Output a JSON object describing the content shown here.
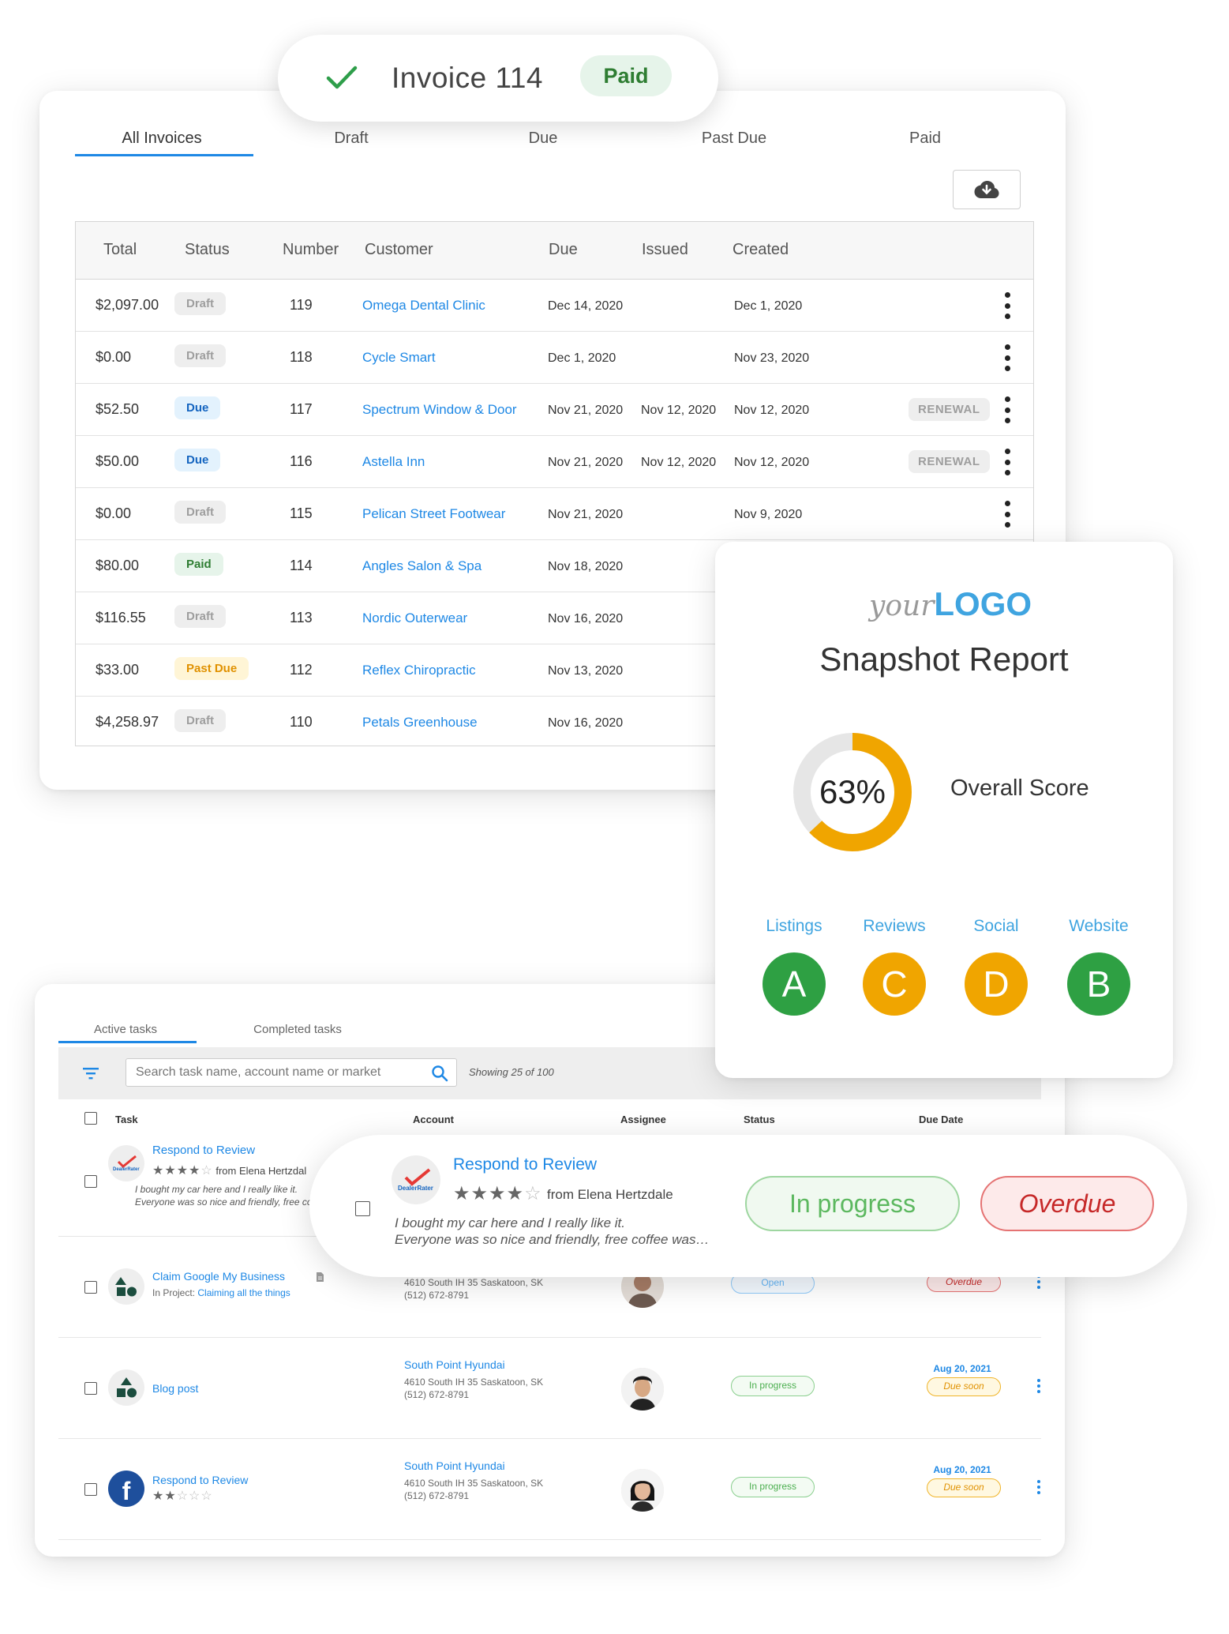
{
  "invoice_toast": {
    "title": "Invoice 114",
    "badge": "Paid"
  },
  "invoice_tabs": [
    "All Invoices",
    "Draft",
    "Due",
    "Past Due",
    "Paid"
  ],
  "invoice_table": {
    "headers": [
      "Total",
      "Status",
      "Number",
      "Customer",
      "Due",
      "Issued",
      "Created"
    ],
    "rows": [
      {
        "total": "$2,097.00",
        "status": "Draft",
        "number": "119",
        "customer": "Omega Dental Clinic",
        "due": "Dec 14, 2020",
        "issued": "",
        "created": "Dec 1, 2020",
        "tag": ""
      },
      {
        "total": "$0.00",
        "status": "Draft",
        "number": "118",
        "customer": "Cycle Smart",
        "due": "Dec 1, 2020",
        "issued": "",
        "created": "Nov 23, 2020",
        "tag": ""
      },
      {
        "total": "$52.50",
        "status": "Due",
        "number": "117",
        "customer": "Spectrum Window & Door",
        "due": "Nov 21, 2020",
        "issued": "Nov 12, 2020",
        "created": "Nov 12, 2020",
        "tag": "RENEWAL"
      },
      {
        "total": "$50.00",
        "status": "Due",
        "number": "116",
        "customer": "Astella Inn",
        "due": "Nov 21, 2020",
        "issued": "Nov 12, 2020",
        "created": "Nov 12, 2020",
        "tag": "RENEWAL"
      },
      {
        "total": "$0.00",
        "status": "Draft",
        "number": "115",
        "customer": "Pelican Street Footwear",
        "due": "Nov 21, 2020",
        "issued": "",
        "created": "Nov 9, 2020",
        "tag": ""
      },
      {
        "total": "$80.00",
        "status": "Paid",
        "number": "114",
        "customer": "Angles Salon & Spa",
        "due": "Nov 18, 2020",
        "issued": "",
        "created": "",
        "tag": ""
      },
      {
        "total": "$116.55",
        "status": "Draft",
        "number": "113",
        "customer": "Nordic Outerwear",
        "due": "Nov 16, 2020",
        "issued": "",
        "created": "",
        "tag": ""
      },
      {
        "total": "$33.00",
        "status": "Past Due",
        "number": "112",
        "customer": "Reflex Chiropractic",
        "due": "Nov 13, 2020",
        "issued": "",
        "created": "",
        "tag": ""
      },
      {
        "total": "$4,258.97",
        "status": "Draft",
        "number": "110",
        "customer": "Petals Greenhouse",
        "due": "Nov 16, 2020",
        "issued": "",
        "created": "",
        "tag": ""
      }
    ]
  },
  "snapshot": {
    "logo_your": "your",
    "logo_logo": "LOGO",
    "title": "Snapshot Report",
    "score": 0.63,
    "score_label": "63%",
    "overall_label": "Overall Score",
    "score_color": "#f0a500",
    "grades": [
      {
        "category": "Listings",
        "grade": "A",
        "color": "#2ea043"
      },
      {
        "category": "Reviews",
        "grade": "C",
        "color": "#f0a500"
      },
      {
        "category": "Social",
        "grade": "D",
        "color": "#f0a500"
      },
      {
        "category": "Website",
        "grade": "B",
        "color": "#2ea043"
      }
    ]
  },
  "tasks": {
    "tabs": [
      "Active tasks",
      "Completed tasks"
    ],
    "search_placeholder": "Search task name, account name or market",
    "showing": "Showing 25 of 100",
    "headers": [
      "Task",
      "Account",
      "Assignee",
      "Status",
      "Due Date"
    ],
    "rows": [
      {
        "name": "Respond to Review",
        "from": "from Elena Hertzdal",
        "quote1": "I bought my car here and I really like it.",
        "quote2": "Everyone was so nice and friendly, free cof"
      },
      {
        "name": "Claim Google My Business",
        "project_prefix": "In Project:",
        "project": "Claiming all the things",
        "addr1": "4610 South IH 35 Saskatoon, SK",
        "addr2": "(512) 672-8791",
        "status": "Open",
        "due_status": "Overdue"
      },
      {
        "name": "Blog post",
        "account": "South Point Hyundai",
        "addr1": "4610 South IH 35 Saskatoon, SK",
        "addr2": "(512) 672-8791",
        "status": "In progress",
        "due": "Aug 20, 2021",
        "due_status": "Due soon"
      },
      {
        "name": "Respond to Review",
        "account": "South Point Hyundai",
        "addr1": "4610 South IH 35 Saskatoon, SK",
        "addr2": "(512) 672-8791",
        "status": "In progress",
        "due": "Aug 20, 2021",
        "due_status": "Due soon"
      }
    ]
  },
  "review_card": {
    "title": "Respond to Review",
    "rating": 4,
    "from": "from Elena Hertzdale",
    "quote1": "I bought my car here and I really like it.",
    "quote2": "Everyone was so nice and friendly, free coffee was…",
    "status": "In progress",
    "due_status": "Overdue"
  }
}
